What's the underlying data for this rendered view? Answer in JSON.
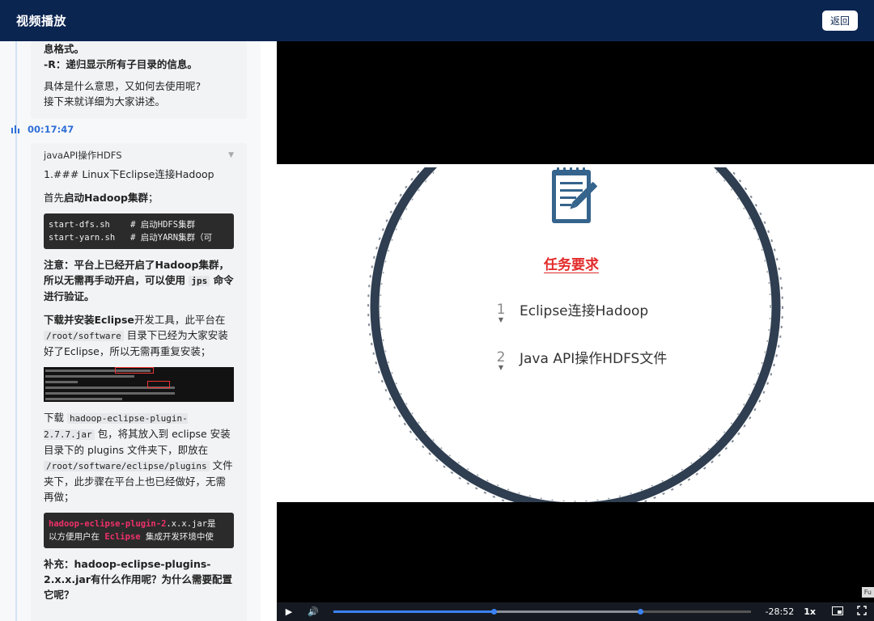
{
  "header": {
    "title": "视频播放",
    "back_label": "返回"
  },
  "notes": {
    "card1": {
      "line1": "息格式。",
      "line2": "-R：递归显示所有子目录的信息。",
      "line3": "具体是什么意思，又如何去使用呢?",
      "line4": "接下来就详细为大家讲述。"
    },
    "timestamp": "00:17:47",
    "card2": {
      "heading": "javaAPI操作HDFS",
      "section": "1.### Linux下Eclipse连接Hadoop",
      "p1_pre": "首先",
      "p1_bold": "启动Hadoop集群",
      "p1_post": "；",
      "code1_line1": "start-dfs.sh    # 启动HDFS集群",
      "code1_line2": "start-yarn.sh   # 启动YARN集群（可",
      "note_pre": "注意：平台上已经开启了Hadoop集群，所以无需再手动开启，可以使用",
      "note_code": "jps",
      "note_post": "命令进行验证。",
      "p2_bold": "下载并安装Eclipse",
      "p2_a": "开发工具，此平台在",
      "p2_code": "/root/software",
      "p2_b": "目录下已经为大家安装好了Eclipse，所以无需再重复安装；",
      "p3_a": "下载",
      "p3_code": "hadoop-eclipse-plugin-2.7.7.jar",
      "p3_b": "包，将其放入到 eclipse 安装目录下的 plugins 文件夹下，即放在",
      "p3_code2": "/root/software/eclipse/plugins",
      "p3_c": "文件夹下，此步骤在平台上也已经做好，无需再做；",
      "code2_pink": "hadoop-eclipse-plugin-2",
      "code2_rest": ".x.x.jar是",
      "code2_line2_a": "以方便用户在 ",
      "code2_line2_pink": "Eclipse",
      "code2_line2_b": " 集成开发环境中使",
      "p4": "补充：hadoop-eclipse-plugins-2.x.x.jar有什么作用呢？为什么需要配置它呢？"
    }
  },
  "slide": {
    "title": "任务要求",
    "items": [
      {
        "num": "1",
        "text": "Eclipse连接Hadoop"
      },
      {
        "num": "2",
        "text": "Java API操作HDFS文件"
      }
    ]
  },
  "player": {
    "remaining": "-28:52",
    "rate": "1x",
    "progress": 0.385,
    "buffer_to": 0.735,
    "full_tip": "Fu",
    "icons": [
      "play-icon",
      "volume-icon",
      "pip-icon",
      "fullscreen-icon"
    ]
  },
  "colors": {
    "header": "#0b2551",
    "accent": "#2f6fd8",
    "slide_title": "#e32b2b"
  }
}
